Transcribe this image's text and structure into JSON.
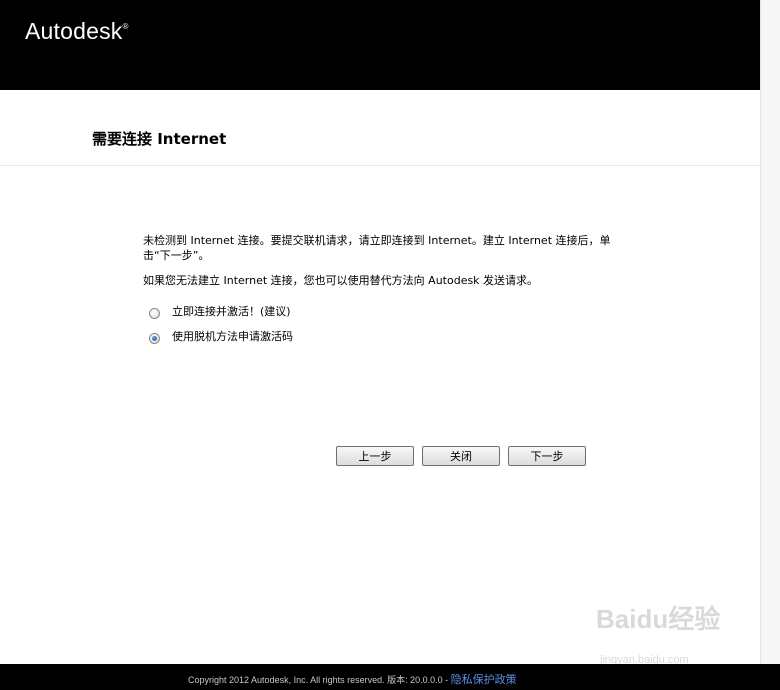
{
  "header": {
    "logo_text": "Autodesk",
    "logo_mark": "®"
  },
  "page_title": "需要连接 Internet",
  "message": {
    "line1": "未检测到 Internet 连接。要提交联机请求，请立即连接到 Internet。建立 Internet 连接后，单击“下一步”。",
    "line2": "如果您无法建立 Internet 连接，您也可以使用替代方法向 Autodesk 发送请求。"
  },
  "options": [
    {
      "label": "立即连接并激活！(建议)",
      "selected": false
    },
    {
      "label": "使用脱机方法申请激活码",
      "selected": true
    }
  ],
  "buttons": {
    "back": "上一步",
    "close": "关闭",
    "next": "下一步"
  },
  "footer": {
    "copyright": "Copyright 2012 Autodesk, Inc. All rights reserved. 版本: 20.0.0.0 - ",
    "privacy_link": "隐私保护政策"
  },
  "watermark": {
    "brand": "Baidu经验",
    "url": "jingyan.baidu.com"
  }
}
